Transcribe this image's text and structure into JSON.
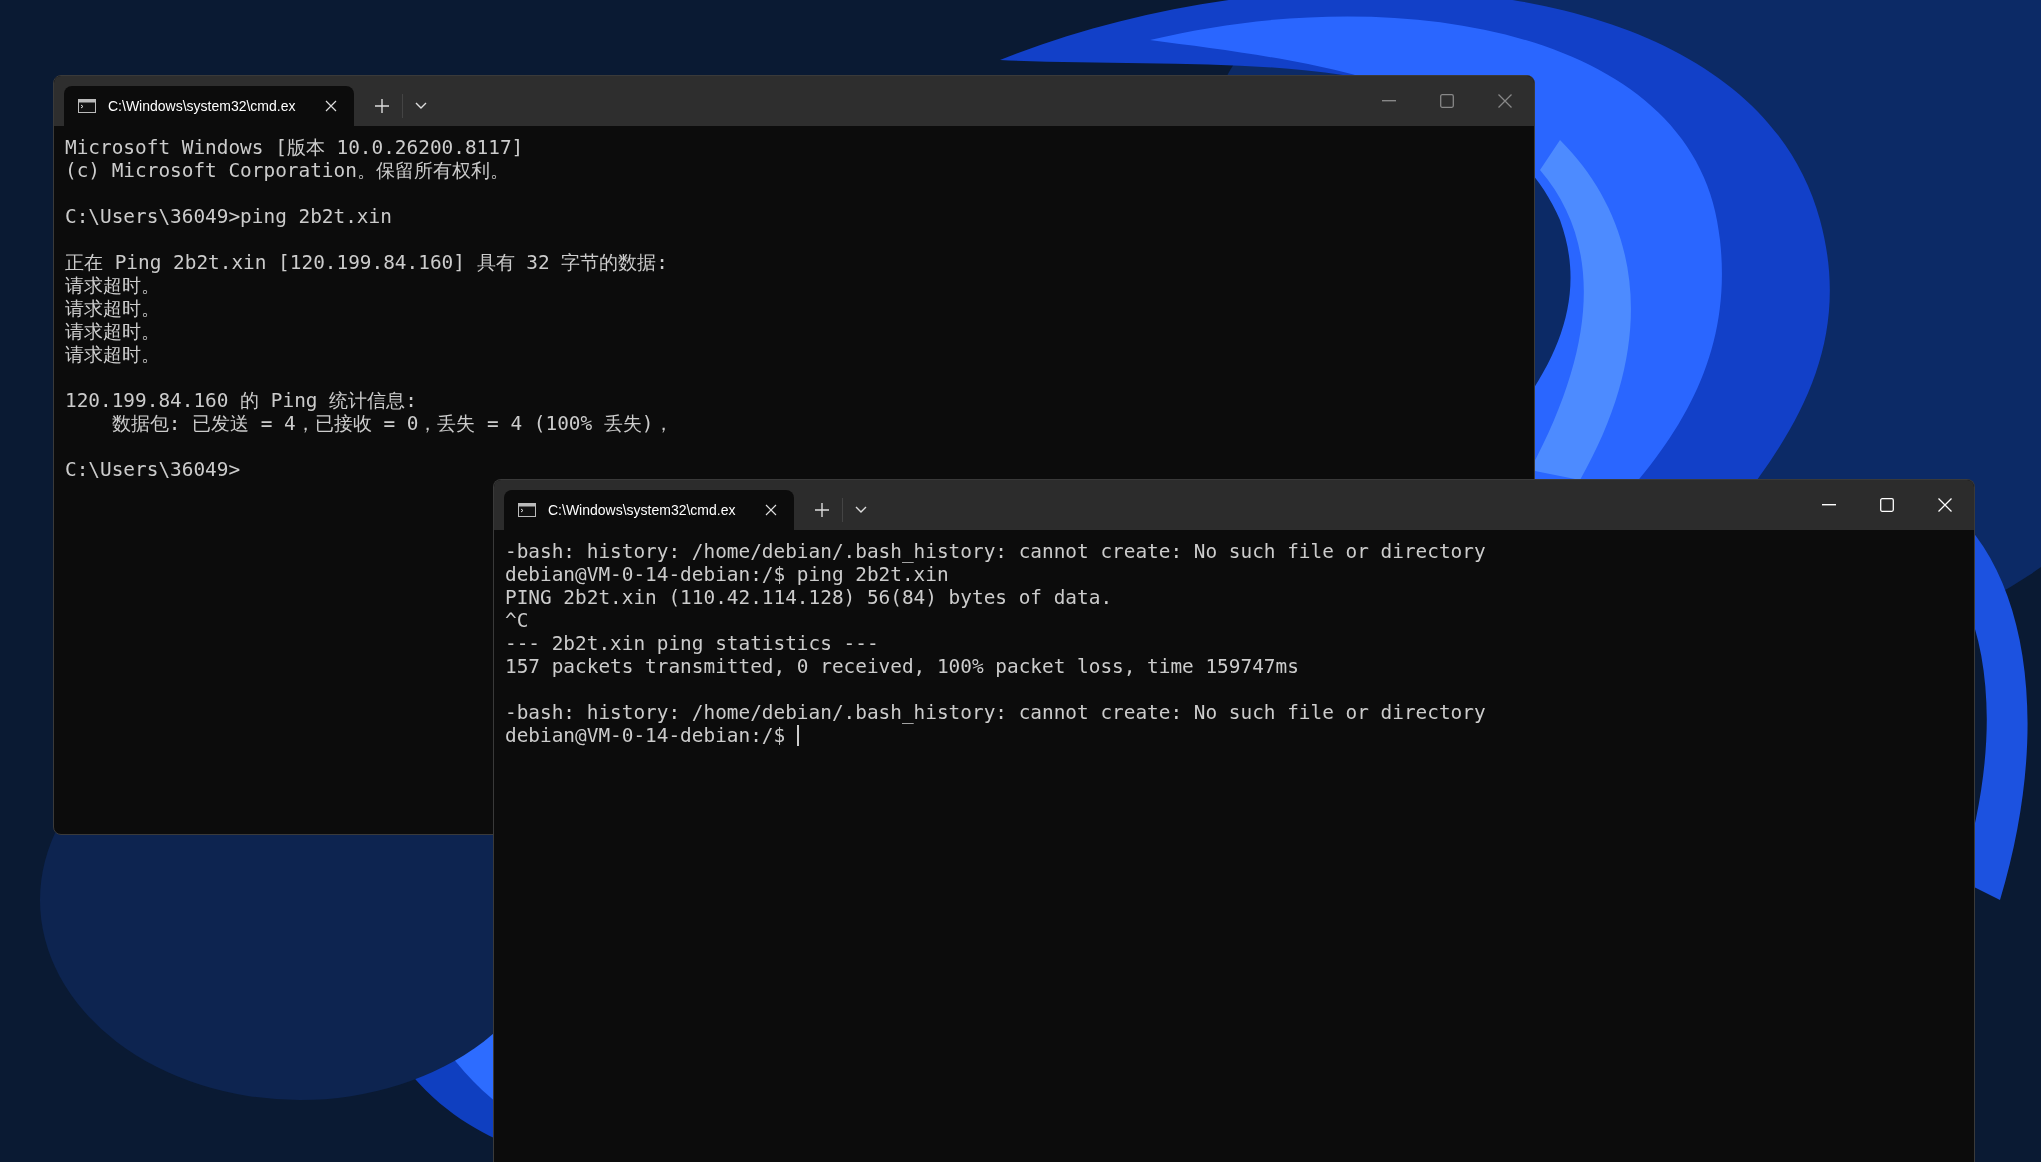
{
  "windows": [
    {
      "focused": false,
      "tab_title": "C:\\Windows\\system32\\cmd.ex",
      "cursor_visible": false,
      "blocks": [
        [
          "Microsoft Windows [版本 10.0.26200.8117]",
          "(c) Microsoft Corporation。保留所有权利。"
        ],
        [
          "C:\\Users\\36049>ping 2b2t.xin"
        ],
        [
          "正在 Ping 2b2t.xin [120.199.84.160] 具有 32 字节的数据:",
          "请求超时。",
          "请求超时。",
          "请求超时。",
          "请求超时。"
        ],
        [
          "120.199.84.160 的 Ping 统计信息:",
          "    数据包: 已发送 = 4，已接收 = 0，丢失 = 4 (100% 丢失)，"
        ],
        [
          "C:\\Users\\36049>"
        ]
      ]
    },
    {
      "focused": true,
      "tab_title": "C:\\Windows\\system32\\cmd.ex",
      "cursor_visible": true,
      "blocks": [
        [
          "-bash: history: /home/debian/.bash_history: cannot create: No such file or directory",
          "debian@VM-0-14-debian:/$ ping 2b2t.xin",
          "PING 2b2t.xin (110.42.114.128) 56(84) bytes of data.",
          "^C",
          "--- 2b2t.xin ping statistics ---",
          "157 packets transmitted, 0 received, 100% packet loss, time 159747ms"
        ],
        [
          "-bash: history: /home/debian/.bash_history: cannot create: No such file or directory",
          "debian@VM-0-14-debian:/$ "
        ]
      ]
    }
  ]
}
